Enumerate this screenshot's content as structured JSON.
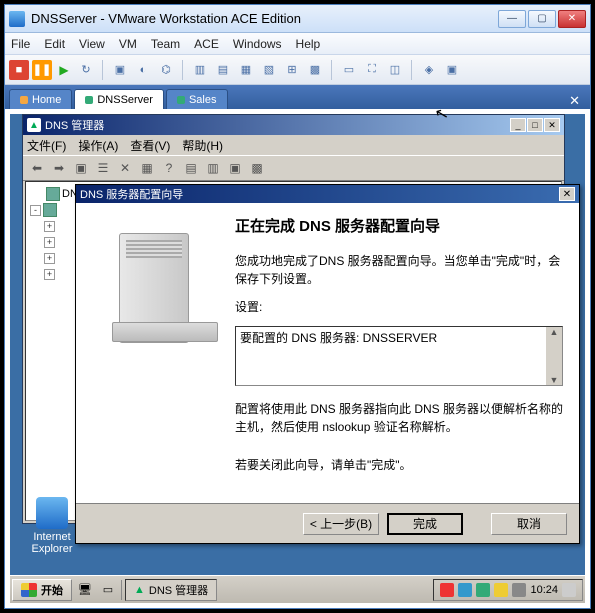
{
  "vmware": {
    "title": "DNSServer - VMware Workstation ACE Edition",
    "menus": [
      "File",
      "Edit",
      "View",
      "VM",
      "Team",
      "ACE",
      "Windows",
      "Help"
    ],
    "tabs": [
      {
        "label": "Home",
        "active": false
      },
      {
        "label": "DNSServer",
        "active": true
      },
      {
        "label": "Sales",
        "active": false
      }
    ]
  },
  "mmc": {
    "title": "DNS 管理器",
    "menus": {
      "file": "文件(F)",
      "action": "操作(A)",
      "view": "查看(V)",
      "help": "帮助(H)"
    },
    "tree_root": "DNS"
  },
  "wizard": {
    "title": "DNS 服务器配置向导",
    "heading": "正在完成 DNS 服务器配置向导",
    "para1": "您成功地完成了DNS 服务器配置向导。当您单击\"完成\"时，会保存下列设置。",
    "settings_label": "设置:",
    "settings_text": "要配置的 DNS 服务器: DNSSERVER",
    "para2": "配置将使用此 DNS 服务器指向此 DNS 服务器以便解析名称的主机，然后使用 nslookup 验证名称解析。",
    "para3": "若要关闭此向导，请单击\"完成\"。",
    "buttons": {
      "back": "< 上一步(B)",
      "finish": "完成",
      "cancel": "取消"
    }
  },
  "desktop": {
    "ie_label": "Internet Explorer"
  },
  "taskbar": {
    "start": "开始",
    "task_btn": "DNS 管理器",
    "clock": "10:24"
  }
}
